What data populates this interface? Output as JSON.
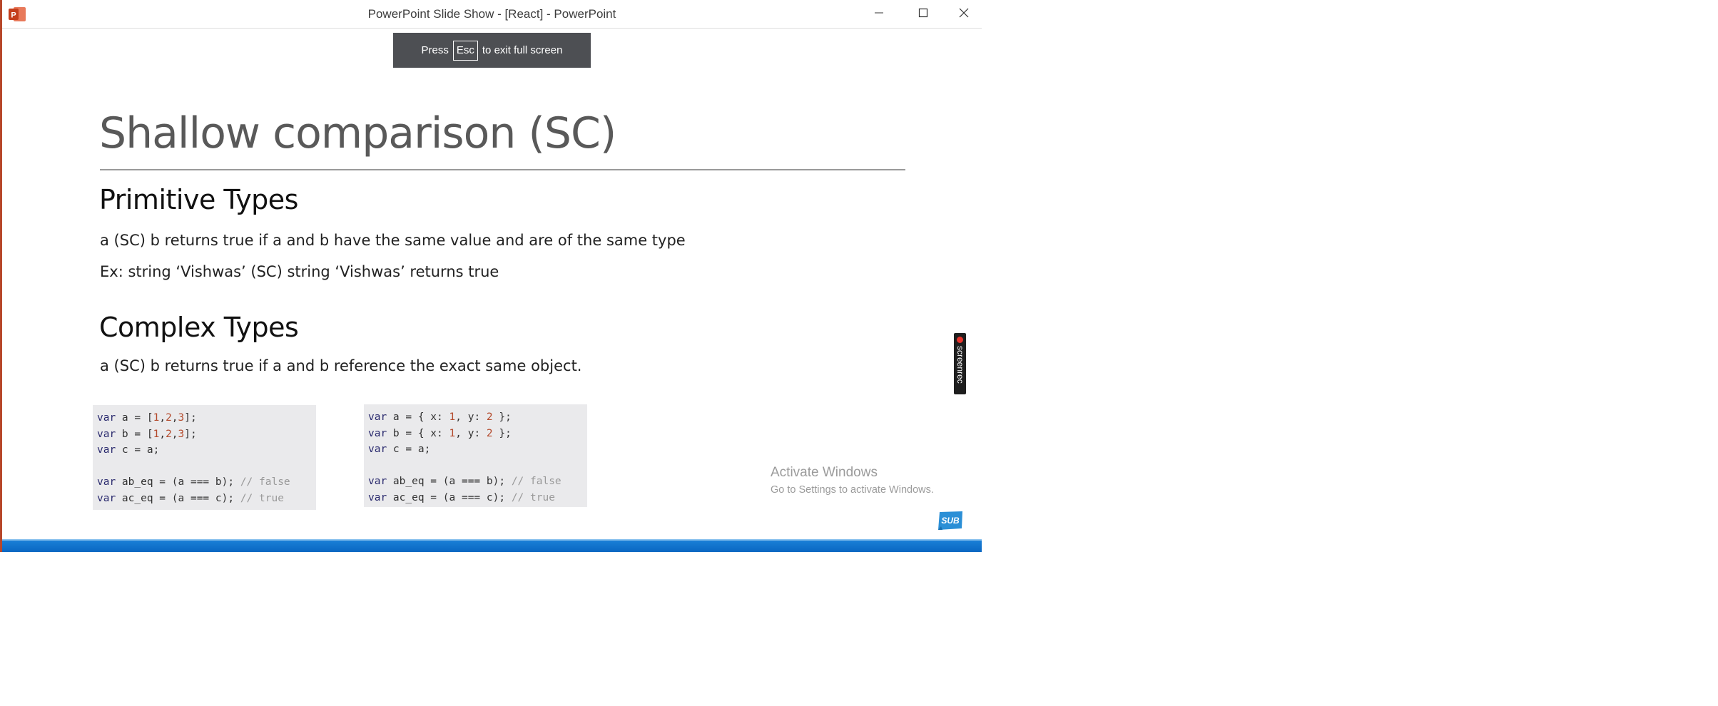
{
  "window": {
    "title": "PowerPoint Slide Show - [React] - PowerPoint",
    "app_icon": "powerpoint-icon",
    "controls": [
      "minimize-icon",
      "maximize-icon",
      "close-icon"
    ]
  },
  "toast": {
    "before": "Press",
    "key": "Esc",
    "after": "to exit full screen"
  },
  "slide": {
    "title": "Shallow comparison (SC)",
    "sections": [
      {
        "heading": "Primitive Types",
        "lines": [
          "a (SC) b returns true if a and b have the same value and are of the same type",
          "Ex: string ‘Vishwas’ (SC) string ‘Vishwas’ returns true"
        ]
      },
      {
        "heading": "Complex Types",
        "lines": [
          "a (SC) b returns true if a and b reference the exact same object."
        ]
      }
    ],
    "code_left": [
      "var a = [1,2,3];",
      "var b = [1,2,3];",
      "var c = a;",
      "",
      "var ab_eq = (a === b); // false",
      "var ac_eq = (a === c); // true"
    ],
    "code_right": [
      "var a = { x: 1, y: 2 };",
      "var b = { x: 1, y: 2 };",
      "var c = a;",
      "",
      "var ab_eq = (a === b); // false",
      "var ac_eq = (a === c); // true"
    ]
  },
  "watermark": {
    "title": "Activate Windows",
    "subtitle": "Go to Settings to activate Windows."
  },
  "screenrec": {
    "label": "screenrec"
  },
  "badge": {
    "label": "SUB"
  },
  "colors": {
    "accent_bar": "#0a67c2",
    "toast_bg": "#4d4f53",
    "powerpoint_brand": "#b7472a"
  }
}
